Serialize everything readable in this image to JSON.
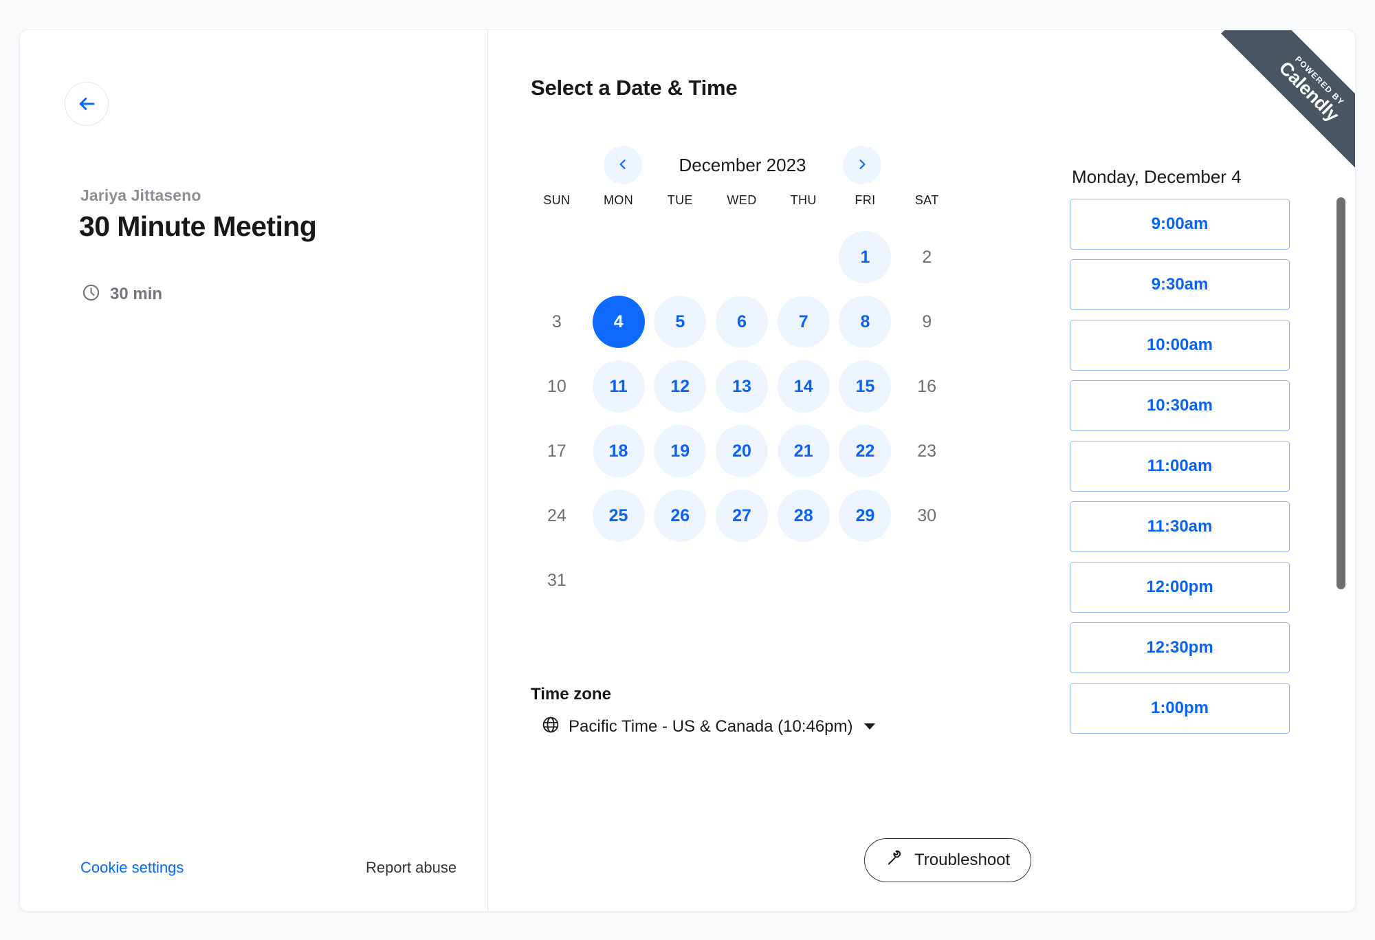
{
  "ribbon": {
    "powered_by": "POWERED BY",
    "brand": "Calendly",
    "background": "#4a5561"
  },
  "left_panel": {
    "back_icon": "arrow-left-icon",
    "organizer": "Jariya Jittaseno",
    "event_title": "30 Minute Meeting",
    "duration_icon": "clock-icon",
    "duration": "30 min",
    "cookie_settings": "Cookie settings",
    "report_abuse": "Report abuse",
    "link_color": "#0069ff"
  },
  "calendar": {
    "section_title": "Select a Date & Time",
    "prev_icon": "chevron-left-icon",
    "next_icon": "chevron-right-icon",
    "month_label": "December 2023",
    "weekdays": [
      "SUN",
      "MON",
      "TUE",
      "WED",
      "THU",
      "FRI",
      "SAT"
    ],
    "leading_blanks": 5,
    "days": [
      {
        "n": "1",
        "state": "available"
      },
      {
        "n": "2",
        "state": "unavailable"
      },
      {
        "n": "3",
        "state": "unavailable"
      },
      {
        "n": "4",
        "state": "selected"
      },
      {
        "n": "5",
        "state": "available"
      },
      {
        "n": "6",
        "state": "available"
      },
      {
        "n": "7",
        "state": "available"
      },
      {
        "n": "8",
        "state": "available"
      },
      {
        "n": "9",
        "state": "unavailable"
      },
      {
        "n": "10",
        "state": "unavailable"
      },
      {
        "n": "11",
        "state": "available"
      },
      {
        "n": "12",
        "state": "available"
      },
      {
        "n": "13",
        "state": "available"
      },
      {
        "n": "14",
        "state": "available"
      },
      {
        "n": "15",
        "state": "available"
      },
      {
        "n": "16",
        "state": "unavailable"
      },
      {
        "n": "17",
        "state": "unavailable"
      },
      {
        "n": "18",
        "state": "available"
      },
      {
        "n": "19",
        "state": "available"
      },
      {
        "n": "20",
        "state": "available"
      },
      {
        "n": "21",
        "state": "available"
      },
      {
        "n": "22",
        "state": "available"
      },
      {
        "n": "23",
        "state": "unavailable"
      },
      {
        "n": "24",
        "state": "unavailable"
      },
      {
        "n": "25",
        "state": "available"
      },
      {
        "n": "26",
        "state": "available"
      },
      {
        "n": "27",
        "state": "available"
      },
      {
        "n": "28",
        "state": "available"
      },
      {
        "n": "29",
        "state": "available"
      },
      {
        "n": "30",
        "state": "unavailable"
      },
      {
        "n": "31",
        "state": "unavailable"
      }
    ],
    "selected_color": "#0f6bff",
    "available_bg": "#eef4fe",
    "available_color": "#0a63f5"
  },
  "timezone": {
    "title": "Time zone",
    "icon": "globe-icon",
    "value": "Pacific Time - US & Canada (10:46pm)",
    "caret_icon": "caret-down-icon"
  },
  "troubleshoot": {
    "icon": "wrench-icon",
    "label": "Troubleshoot"
  },
  "slots": {
    "selected_date": "Monday, December 4",
    "times": [
      "9:00am",
      "9:30am",
      "10:00am",
      "10:30am",
      "11:00am",
      "11:30am",
      "12:00pm",
      "12:30pm",
      "1:00pm"
    ],
    "border_color": "#91b7fb",
    "text_color": "#0a63f5"
  }
}
